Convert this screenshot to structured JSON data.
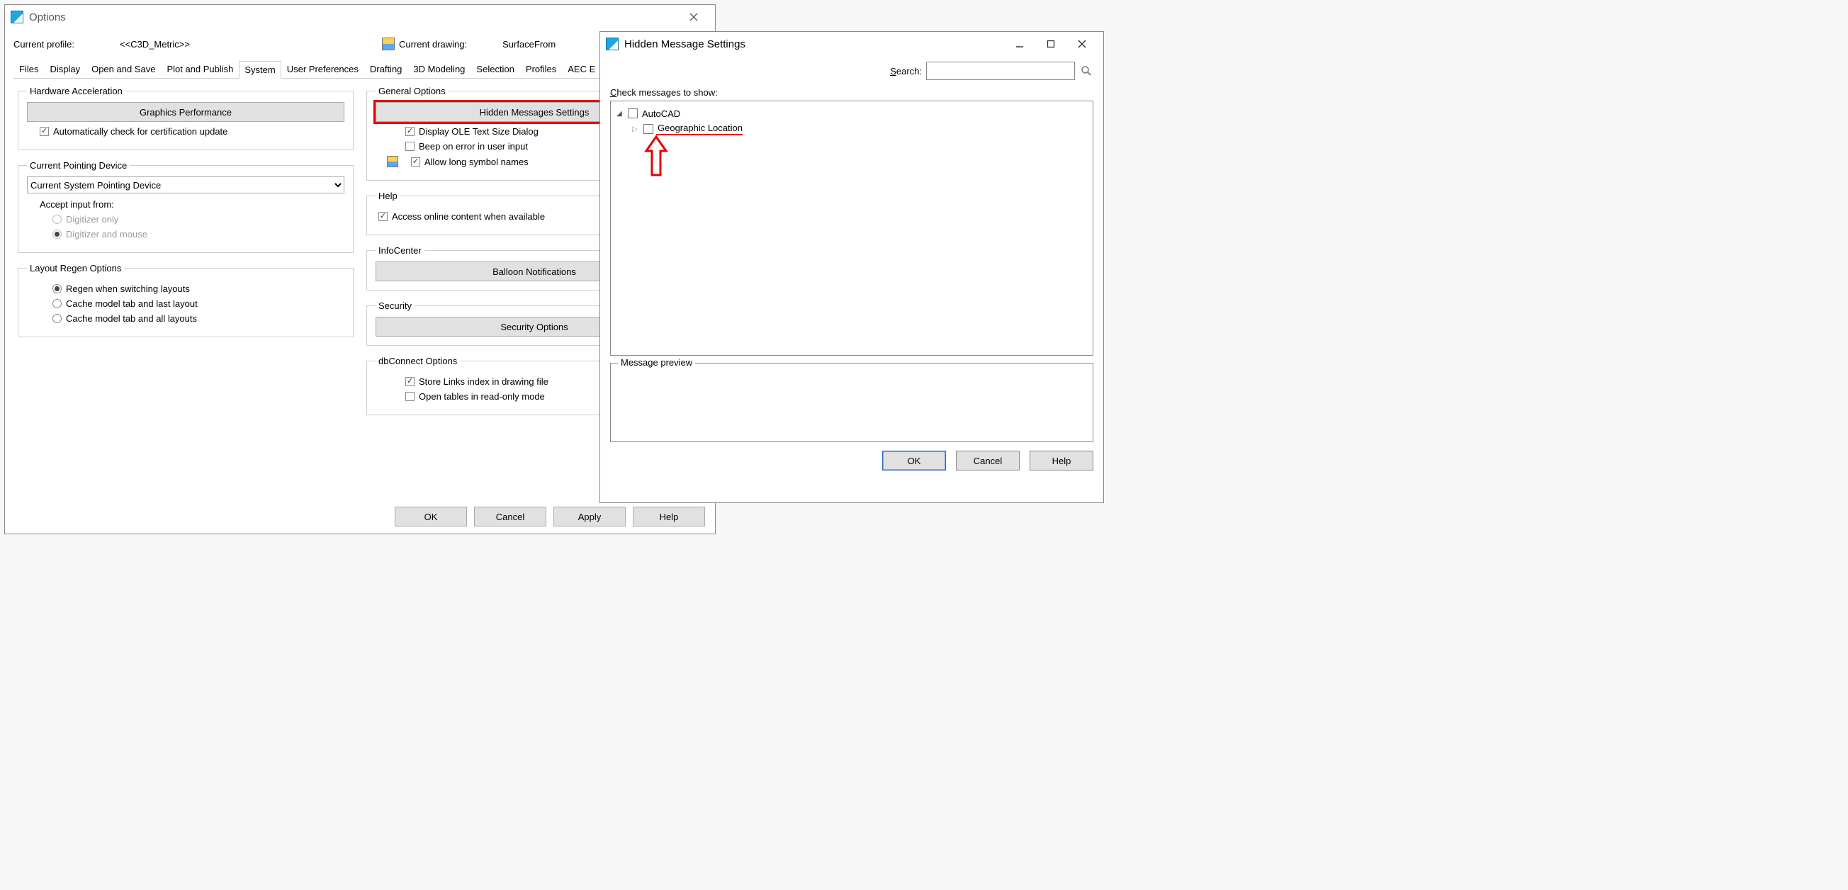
{
  "options": {
    "title": "Options",
    "profile_label": "Current profile:",
    "profile_value": "<<C3D_Metric>>",
    "drawing_label": "Current drawing:",
    "drawing_value": "SurfaceFrom",
    "tabs": [
      "Files",
      "Display",
      "Open and Save",
      "Plot and Publish",
      "System",
      "User Preferences",
      "Drafting",
      "3D Modeling",
      "Selection",
      "Profiles",
      "AEC E"
    ],
    "active_tab": 4,
    "left": {
      "hw_accel": {
        "legend": "Hardware Acceleration",
        "btn": "Graphics Performance",
        "auto_check": "Automatically check for certification update"
      },
      "pointing": {
        "legend": "Current Pointing Device",
        "combo": "Current System Pointing Device",
        "accept_label": "Accept input from:",
        "digitizer_only": "Digitizer only",
        "digitizer_mouse": "Digitizer and mouse"
      },
      "regen": {
        "legend": "Layout Regen Options",
        "o1": "Regen when switching layouts",
        "o2": "Cache model tab and last layout",
        "o3": "Cache model tab and all layouts"
      }
    },
    "right": {
      "general": {
        "legend": "General Options",
        "hidden_btn": "Hidden Messages Settings",
        "ole_dialog": "Display OLE Text Size Dialog",
        "beep": "Beep on error in user input",
        "long_sym": "Allow long symbol names"
      },
      "help": {
        "legend": "Help",
        "online": "Access online content when available"
      },
      "info": {
        "legend": "InfoCenter",
        "btn": "Balloon Notifications"
      },
      "security": {
        "legend": "Security",
        "btn": "Security Options"
      },
      "db": {
        "legend": "dbConnect Options",
        "store_links": "Store Links index in drawing file",
        "read_only": "Open tables in read-only mode"
      }
    },
    "buttons": {
      "ok": "OK",
      "cancel": "Cancel",
      "apply": "Apply",
      "help": "Help"
    }
  },
  "hms": {
    "title": "Hidden Message Settings",
    "search_label": "Search:",
    "check_label": "Check messages to show:",
    "tree": {
      "root": "AutoCAD",
      "child": "Geographic Location"
    },
    "preview_label": "Message preview",
    "buttons": {
      "ok": "OK",
      "cancel": "Cancel",
      "help": "Help"
    }
  }
}
